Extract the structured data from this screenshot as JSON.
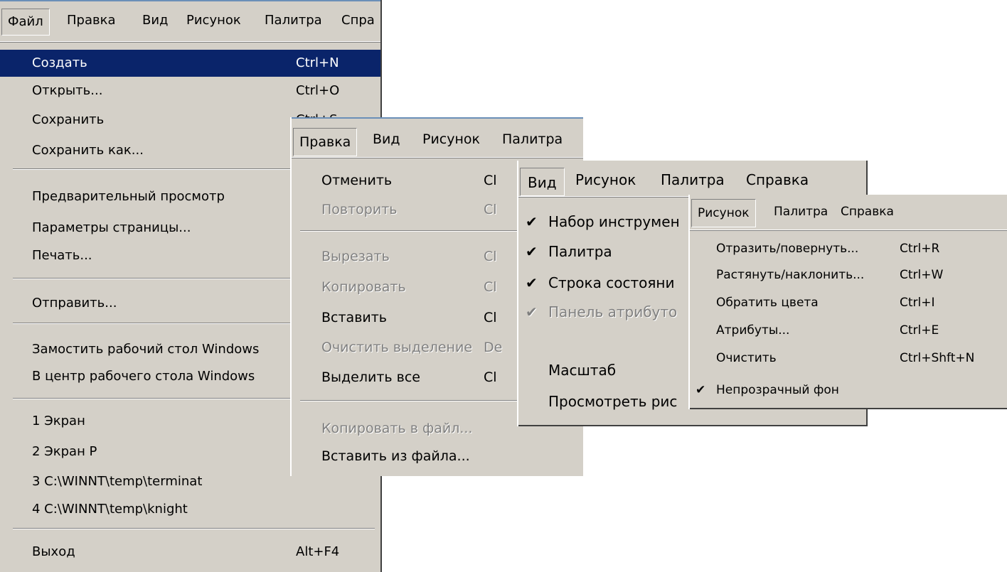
{
  "file_menu": {
    "menubar": [
      "Файл",
      "Правка",
      "Вид",
      "Рисунок",
      "Палитра",
      "Спра"
    ],
    "items": [
      {
        "label": "Создать",
        "shortcut": "Ctrl+N"
      },
      {
        "label": "Открыть...",
        "shortcut": "Ctrl+O"
      },
      {
        "label": "Сохранить",
        "shortcut": "Ctrl+S"
      },
      {
        "label": "Сохранить как...",
        "shortcut": ""
      },
      {
        "label": "Предварительный просмотр",
        "shortcut": ""
      },
      {
        "label": "Параметры страницы...",
        "shortcut": ""
      },
      {
        "label": "Печать...",
        "shortcut": ""
      },
      {
        "label": "Отправить...",
        "shortcut": ""
      },
      {
        "label": "Замостить рабочий стол Windows",
        "shortcut": ""
      },
      {
        "label": "В центр рабочего стола Windows",
        "shortcut": ""
      },
      {
        "label": "1 Экран",
        "shortcut": ""
      },
      {
        "label": "2 Экран Р",
        "shortcut": ""
      },
      {
        "label": "3 C:\\WINNT\\temp\\terminat",
        "shortcut": ""
      },
      {
        "label": "4 C:\\WINNT\\temp\\knight",
        "shortcut": ""
      },
      {
        "label": "Выход",
        "shortcut": "Alt+F4"
      }
    ]
  },
  "edit_menu": {
    "menubar": [
      "Правка",
      "Вид",
      "Рисунок",
      "Палитра"
    ],
    "items": [
      {
        "label": "Отменить",
        "shortcut": "Cl"
      },
      {
        "label": "Повторить",
        "shortcut": "Cl"
      },
      {
        "label": "Вырезать",
        "shortcut": "Cl"
      },
      {
        "label": "Копировать",
        "shortcut": "Cl"
      },
      {
        "label": "Вставить",
        "shortcut": "Cl"
      },
      {
        "label": "Очистить выделение",
        "shortcut": "De"
      },
      {
        "label": "Выделить все",
        "shortcut": "Cl"
      },
      {
        "label": "Копировать в файл...",
        "shortcut": ""
      },
      {
        "label": "Вставить из файла...",
        "shortcut": ""
      }
    ]
  },
  "view_menu": {
    "menubar": [
      "Вид",
      "Рисунок",
      "Палитра",
      "Справка"
    ],
    "check_glyph": "✔",
    "items": [
      {
        "label": "Набор инструмен",
        "shortcut": ""
      },
      {
        "label": "Палитра",
        "shortcut": ""
      },
      {
        "label": "Строка состояни",
        "shortcut": ""
      },
      {
        "label": "Панель атрибуто",
        "shortcut": ""
      },
      {
        "label": "Масштаб",
        "shortcut": ""
      },
      {
        "label": "Просмотреть рис",
        "shortcut": ""
      }
    ]
  },
  "image_menu": {
    "menubar": [
      "Рисунок",
      "Палитра",
      "Справка"
    ],
    "items": [
      {
        "label": "Отразить/повернуть...",
        "shortcut": "Ctrl+R"
      },
      {
        "label": "Растянуть/наклонить...",
        "shortcut": "Ctrl+W"
      },
      {
        "label": "Обратить цвета",
        "shortcut": "Ctrl+I"
      },
      {
        "label": "Атрибуты...",
        "shortcut": "Ctrl+E"
      },
      {
        "label": "Очистить",
        "shortcut": "Ctrl+Shft+N"
      },
      {
        "label": "Непрозрачный фон",
        "shortcut": ""
      }
    ]
  },
  "colors": {
    "menu_bg": "#d4d0c8",
    "highlight": "#0a246a",
    "disabled": "#808080"
  }
}
